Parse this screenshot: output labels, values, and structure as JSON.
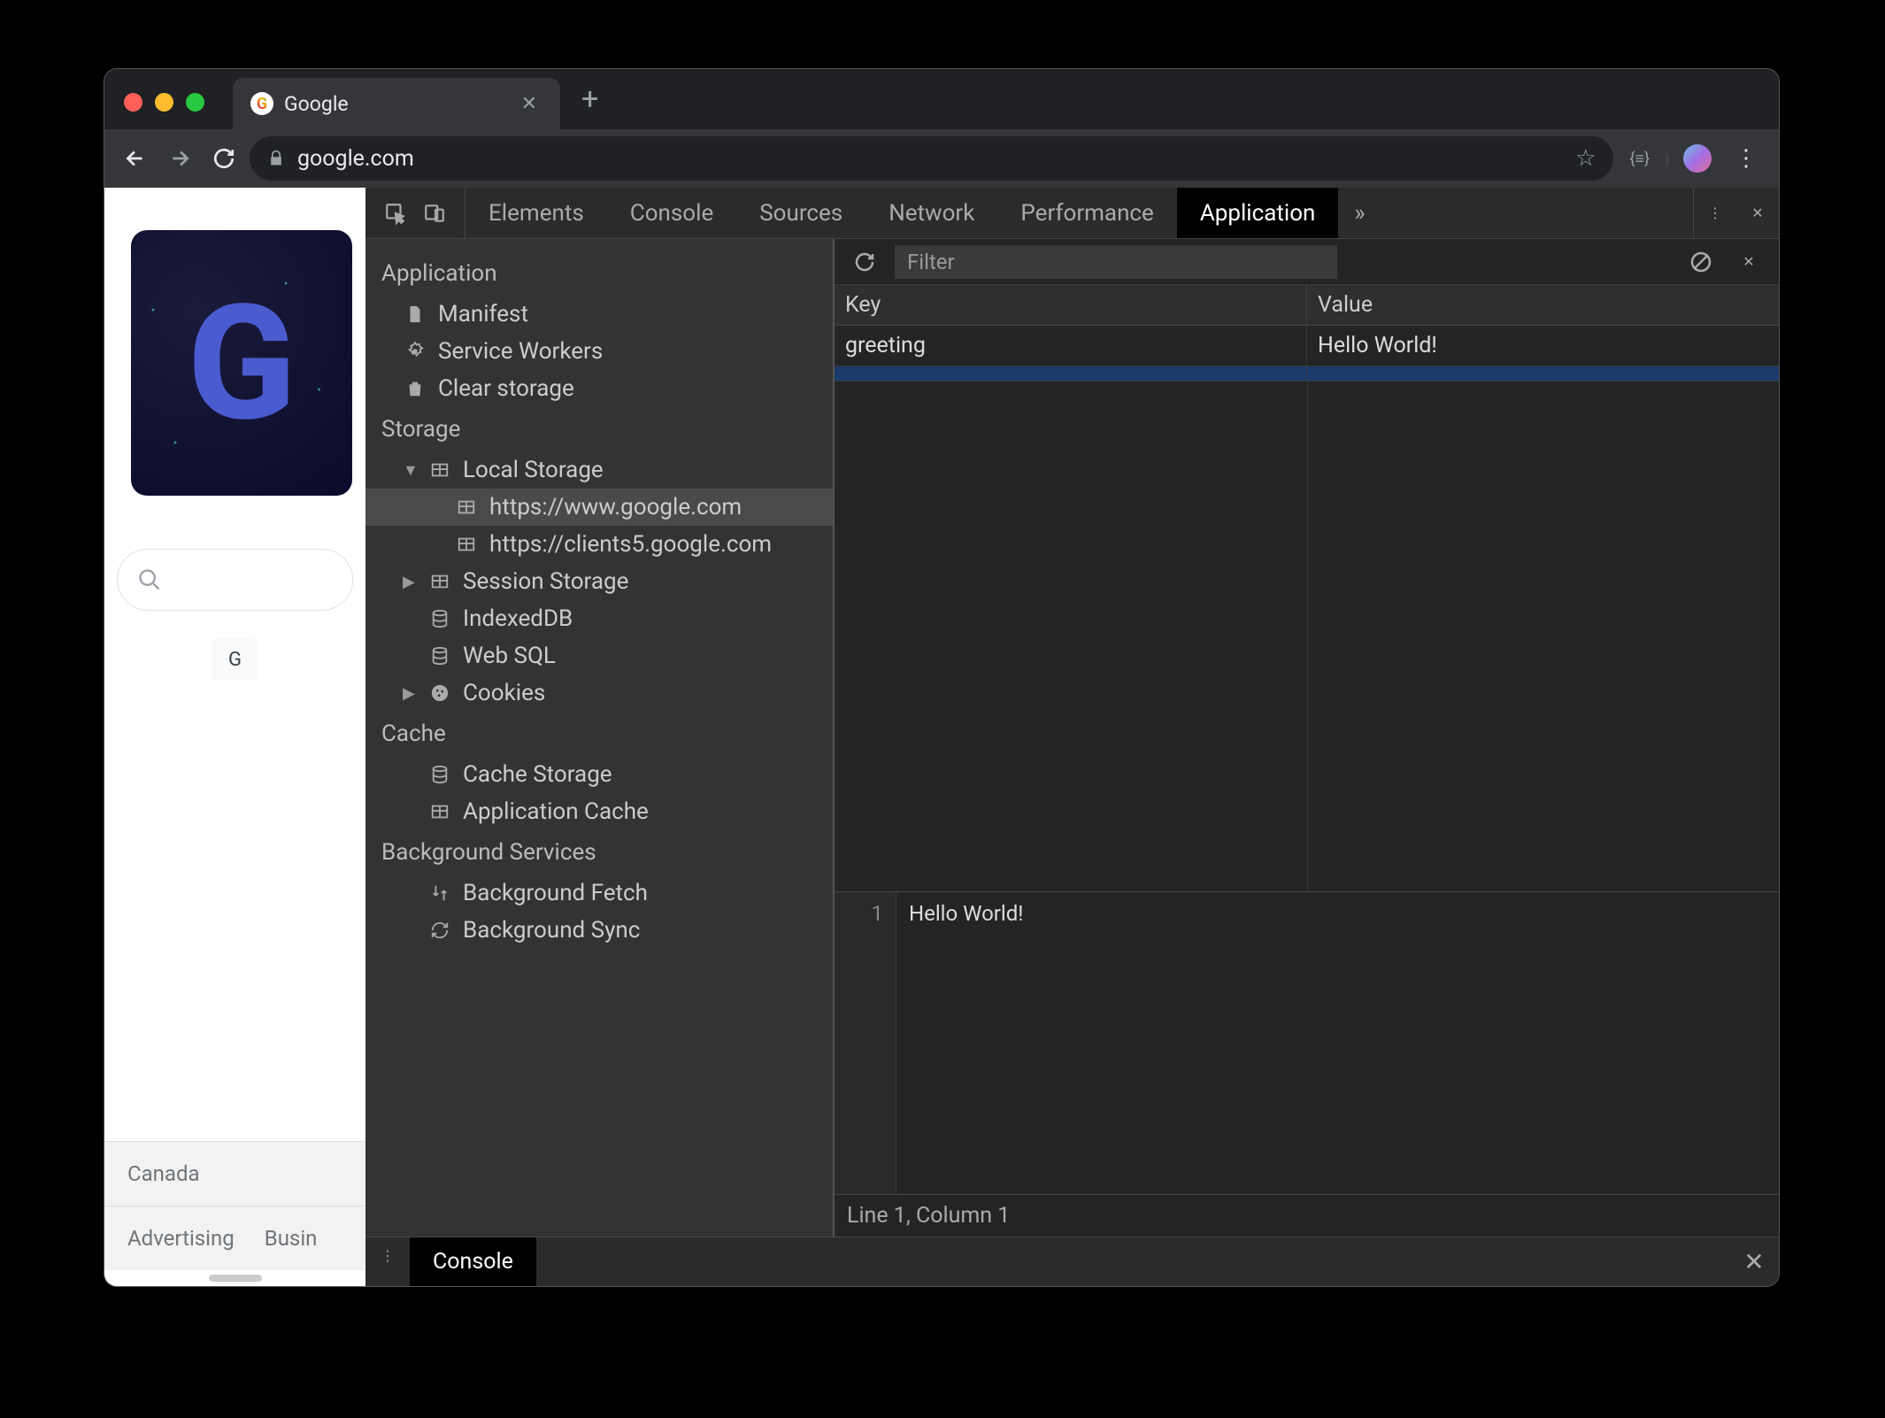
{
  "browser": {
    "tab_title": "Google",
    "url": "google.com"
  },
  "page": {
    "doodle_letter": "G",
    "footer_country": "Canada",
    "footer_links": [
      "Advertising",
      "Busin"
    ]
  },
  "devtools": {
    "tabs": [
      "Elements",
      "Console",
      "Sources",
      "Network",
      "Performance",
      "Application"
    ],
    "active_tab": "Application",
    "sidebar": {
      "application": {
        "heading": "Application",
        "items": [
          "Manifest",
          "Service Workers",
          "Clear storage"
        ]
      },
      "storage": {
        "heading": "Storage",
        "local_storage": {
          "label": "Local Storage",
          "origins": [
            "https://www.google.com",
            "https://clients5.google.com"
          ]
        },
        "session_storage": "Session Storage",
        "indexeddb": "IndexedDB",
        "websql": "Web SQL",
        "cookies": "Cookies"
      },
      "cache": {
        "heading": "Cache",
        "items": [
          "Cache Storage",
          "Application Cache"
        ]
      },
      "background": {
        "heading": "Background Services",
        "items": [
          "Background Fetch",
          "Background Sync"
        ]
      }
    },
    "filter_placeholder": "Filter",
    "table": {
      "headers": [
        "Key",
        "Value"
      ],
      "rows": [
        {
          "key": "greeting",
          "value": "Hello World!"
        }
      ]
    },
    "preview": {
      "line_number": "1",
      "text": "Hello World!",
      "status": "Line 1, Column 1"
    },
    "drawer_tab": "Console"
  }
}
